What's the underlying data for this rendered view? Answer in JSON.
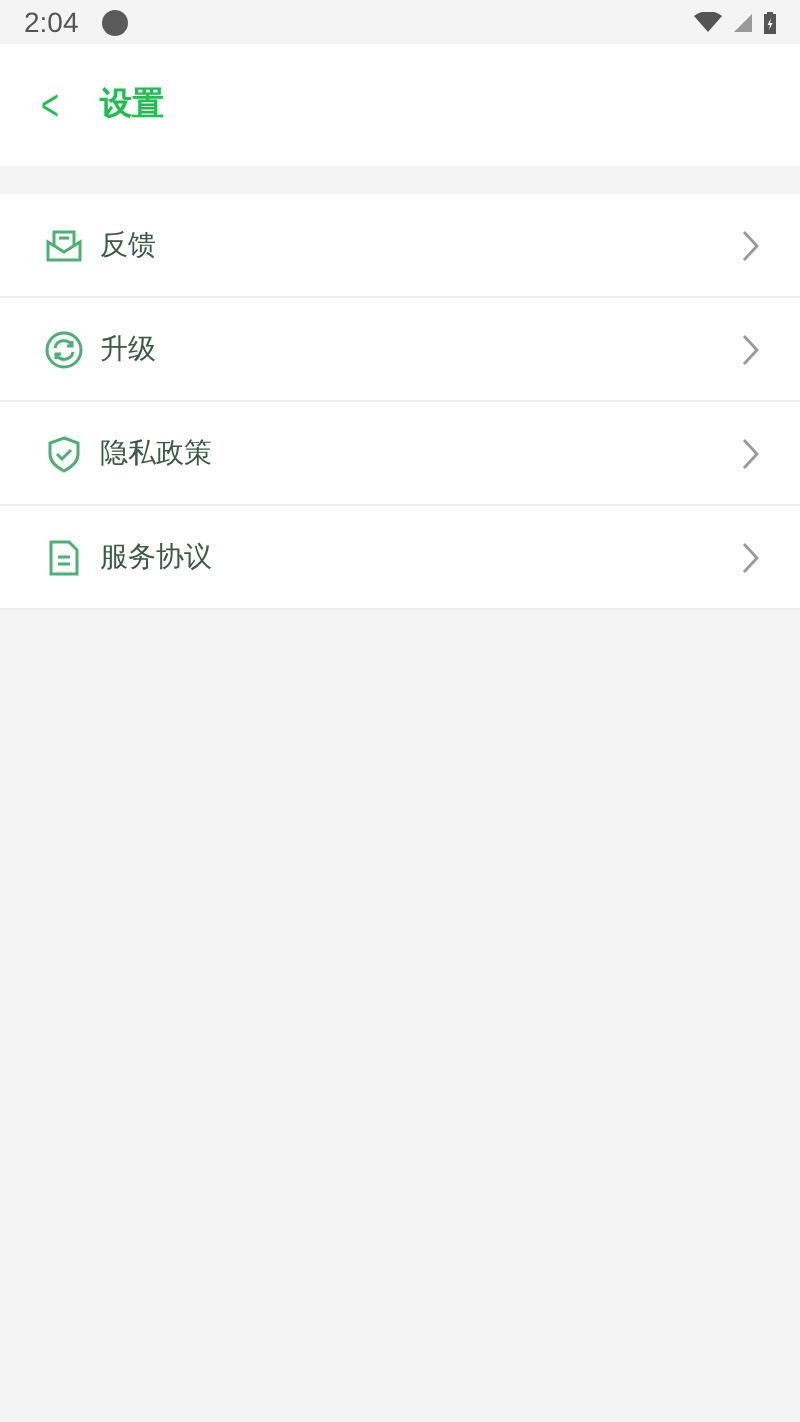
{
  "status_bar": {
    "time": "2:04"
  },
  "header": {
    "back": "<",
    "title": "设置"
  },
  "items": [
    {
      "kind": "feedback",
      "label": "反馈"
    },
    {
      "kind": "upgrade",
      "label": "升级"
    },
    {
      "kind": "privacy",
      "label": "隐私政策"
    },
    {
      "kind": "agreement",
      "label": "服务协议"
    }
  ]
}
